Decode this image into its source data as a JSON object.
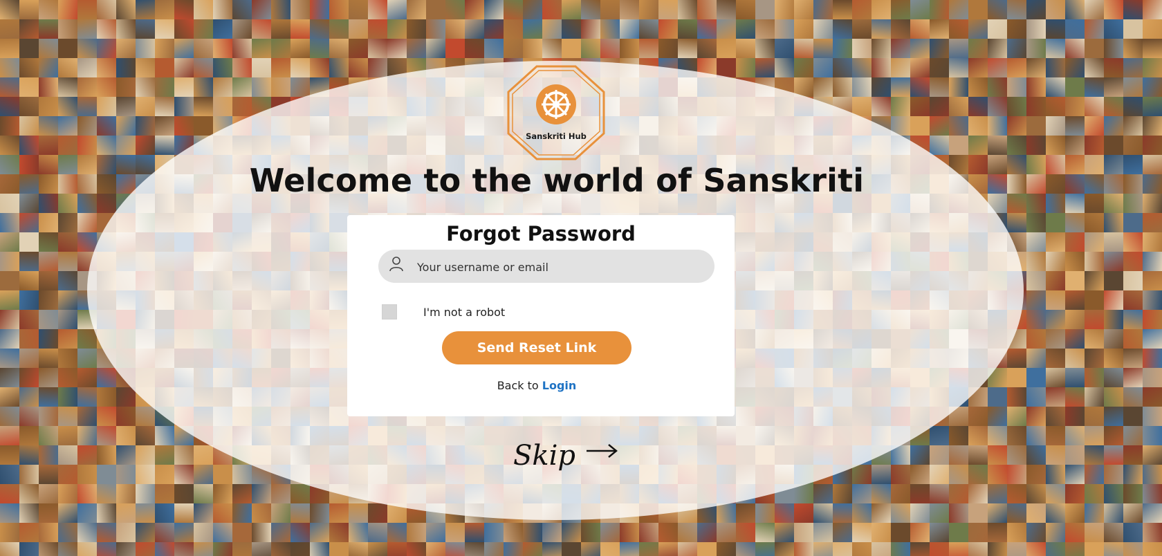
{
  "branding": {
    "logo_text": "Sanskriti Hub",
    "accent_color": "#e8913b"
  },
  "welcome": {
    "title": "Welcome to the world of Sanskriti"
  },
  "forgot_password": {
    "title": "Forgot Password",
    "username_placeholder": "Your username or email",
    "username_icon": "user-icon",
    "captcha_label": "I'm not a robot",
    "submit_label": "Send Reset Link",
    "back_prefix": "Back to ",
    "login_link": "Login",
    "link_color": "#1f73c4"
  },
  "skip": {
    "label": "Skip",
    "icon": "arrow-right-icon"
  }
}
